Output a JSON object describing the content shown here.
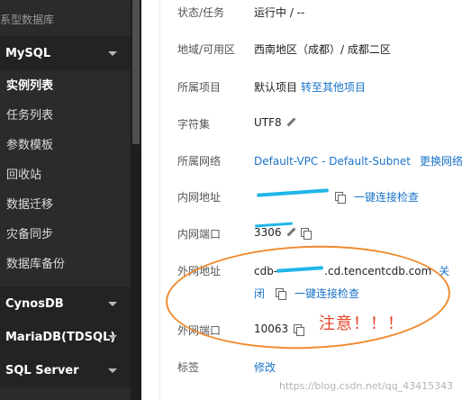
{
  "sidebar": {
    "category": "系型数据库",
    "groups": {
      "mysql": "MySQL",
      "cynosdb": "CynosDB",
      "mariadb": "MariaDB(TDSQL)",
      "sqlserver": "SQL Server"
    },
    "items": [
      {
        "label": "实例列表",
        "active": true
      },
      {
        "label": "任务列表"
      },
      {
        "label": "参数模板"
      },
      {
        "label": "回收站"
      },
      {
        "label": "数据迁移"
      },
      {
        "label": "灾备同步"
      },
      {
        "label": "数据库备份"
      }
    ]
  },
  "detail": {
    "status": {
      "label": "状态/任务",
      "value": "运行中 / --"
    },
    "region": {
      "label": "地域/可用区",
      "value": "西南地区（成都）/ 成都二区"
    },
    "project": {
      "label": "所属项目",
      "value": "默认项目",
      "link": "转至其他项目"
    },
    "charset": {
      "label": "字符集",
      "value": "UTF8"
    },
    "network": {
      "label": "所属网络",
      "value": "Default-VPC - Default-Subnet",
      "link": "更换网络"
    },
    "inner_address": {
      "label": "内网地址",
      "link": "一键连接检查"
    },
    "inner_port": {
      "label": "内网端口",
      "value": "3306"
    },
    "outer_address": {
      "label": "外网地址",
      "value": "cdb-",
      "value_suffix": ".cd.tencentcdb.com",
      "close_line1": "关",
      "close_line2": "闭",
      "link": "一键连接检查"
    },
    "outer_port": {
      "label": "外网端口",
      "value": "10063"
    },
    "tags": {
      "label": "标签",
      "link": "修改"
    }
  },
  "annotation": "注意！！！",
  "watermark": "https://blog.csdn.net/qq_43415343",
  "colors": {
    "link": "#1a73c8",
    "annotation": "#e8452a",
    "circle": "#f08a2e",
    "redaction": "#1fb6e8"
  }
}
